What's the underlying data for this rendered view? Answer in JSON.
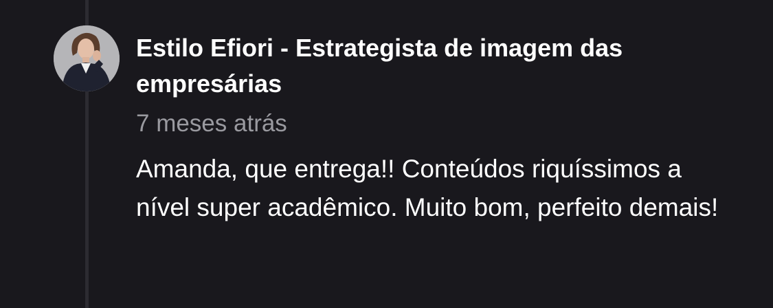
{
  "comment": {
    "author": "Estilo Efiori - Estrategista de imagem das empresárias",
    "timestamp": "7 meses atrás",
    "text": "Amanda, que entrega!! Conteúdos riquíssimos a nível super acadêmico. Muito bom, perfeito demais!"
  },
  "colors": {
    "background": "#19181d",
    "thread_line": "#2c2b31",
    "author": "#ffffff",
    "timestamp": "#9a9aa0",
    "text": "#ffffff"
  },
  "icons": {
    "avatar": "profile-photo-avatar"
  }
}
